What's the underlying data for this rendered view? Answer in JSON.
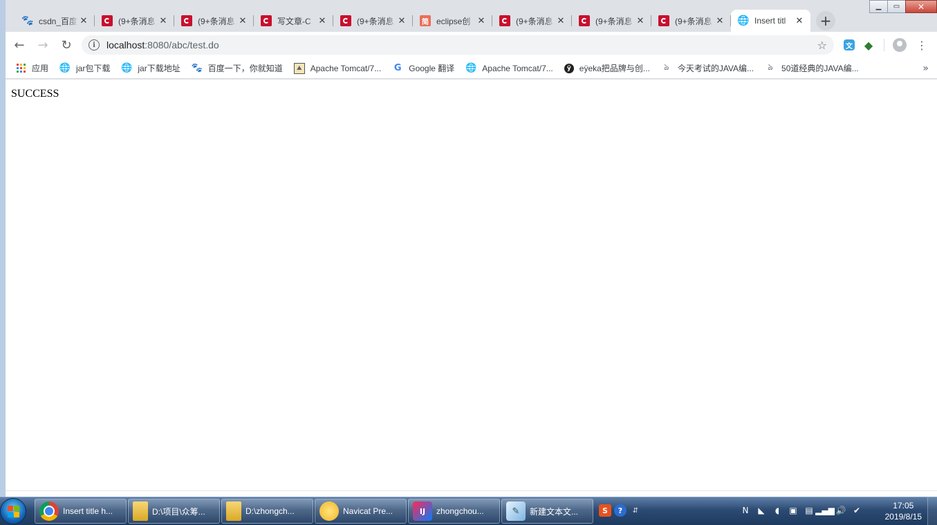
{
  "browser": {
    "tabs": [
      {
        "title": "csdn_百度",
        "icon": "baidu-paw-icon"
      },
      {
        "title": "(9+条消息",
        "icon": "csdn-icon"
      },
      {
        "title": "(9+条消息",
        "icon": "csdn-icon"
      },
      {
        "title": "写文章-C",
        "icon": "csdn-icon"
      },
      {
        "title": "(9+条消息",
        "icon": "csdn-icon"
      },
      {
        "title": "eclipse创",
        "icon": "jianshu-icon"
      },
      {
        "title": "(9+条消息",
        "icon": "csdn-icon"
      },
      {
        "title": "(9+条消息",
        "icon": "csdn-icon"
      },
      {
        "title": "(9+条消息",
        "icon": "csdn-icon"
      },
      {
        "title": "Insert titl",
        "icon": "globe-icon",
        "active": true
      }
    ],
    "address": {
      "host": "localhost",
      "rest": ":8080/abc/test.do"
    },
    "bookmarks": [
      {
        "label": "应用",
        "icon": "apps-icon"
      },
      {
        "label": "jar包下载",
        "icon": "globe-icon"
      },
      {
        "label": "jar下载地址",
        "icon": "globe-icon"
      },
      {
        "label": "百度一下，你就知道",
        "icon": "baidu-paw-icon"
      },
      {
        "label": "Apache Tomcat/7...",
        "icon": "tomcat-icon"
      },
      {
        "label": "Google 翻译",
        "icon": "google-translate-icon"
      },
      {
        "label": "Apache Tomcat/7...",
        "icon": "globe-icon"
      },
      {
        "label": "eÿeka把品牌与创...",
        "icon": "eyeka-icon"
      },
      {
        "label": "今天考试的JAVA编...",
        "icon": "snake-icon"
      },
      {
        "label": "50道经典的JAVA编...",
        "icon": "snake-icon"
      }
    ],
    "bookmarks_more": "»"
  },
  "page": {
    "message": "SUCCESS"
  },
  "taskbar": {
    "items": [
      {
        "label": "Insert title h...",
        "icon": "chrome-icon"
      },
      {
        "label": "D:\\项目\\众筹...",
        "icon": "folder-icon"
      },
      {
        "label": "D:\\zhongch...",
        "icon": "folder-icon"
      },
      {
        "label": "Navicat Pre...",
        "icon": "navicat-icon"
      },
      {
        "label": "zhongchou...",
        "icon": "intellij-icon"
      },
      {
        "label": "新建文本文...",
        "icon": "notepad-icon"
      }
    ],
    "clock": {
      "time": "17:05",
      "date": "2019/8/15"
    }
  },
  "colors": {
    "tabstrip": "#dee1e6",
    "csdn_red": "#c8102e",
    "taskbar": "#2c4b73"
  }
}
